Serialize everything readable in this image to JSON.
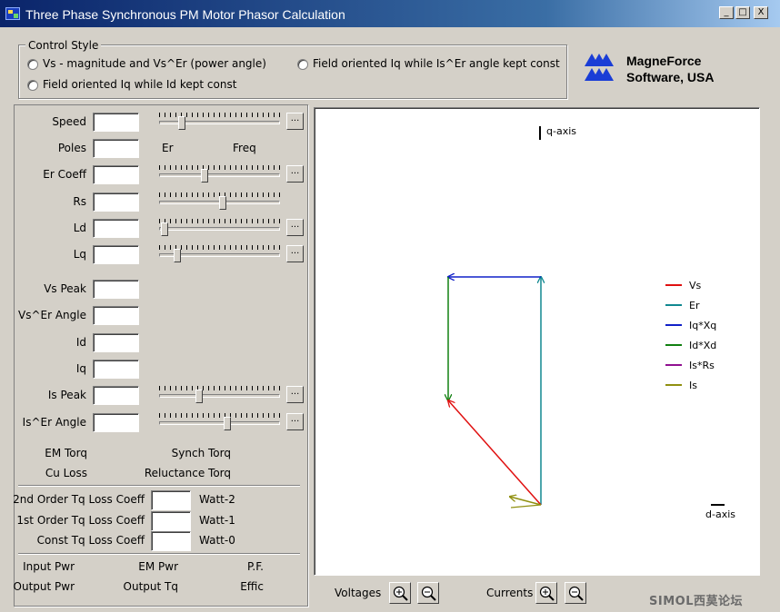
{
  "window": {
    "title": "Three Phase Synchronous PM Motor Phasor Calculation",
    "minimize": "_",
    "maximize": "□",
    "close": "X"
  },
  "control_style": {
    "label": "Control Style",
    "options": [
      {
        "label": "Vs - magnitude and Vs^Er (power angle)",
        "selected": false
      },
      {
        "label": "Field oriented Iq while Is^Er angle kept const",
        "selected": false
      },
      {
        "label": "Field oriented Iq while Id kept const",
        "selected": false
      }
    ]
  },
  "brand": {
    "line1": "MagneForce",
    "line2": "Software, USA"
  },
  "inputs": {
    "speed": "Speed",
    "poles": "Poles",
    "er_coeff": "Er Coeff",
    "rs": "Rs",
    "ld": "Ld",
    "lq": "Lq",
    "er_label": "Er",
    "freq_label": "Freq",
    "dots": "..."
  },
  "sliders": {
    "speed": 0.16,
    "er_coeff": 0.35,
    "rs": 0.51,
    "ld": 0.02,
    "lq": 0.12,
    "is_peak": 0.31,
    "is_er_angle": 0.55
  },
  "outputs": {
    "vs_peak": "Vs Peak",
    "vs_er_angle": "Vs^Er Angle",
    "id": "Id",
    "iq": "Iq",
    "is_peak": "Is Peak",
    "is_er_angle": "Is^Er Angle"
  },
  "torque": {
    "em_torq": "EM Torq",
    "synch_torq": "Synch Torq",
    "cu_loss": "Cu Loss",
    "reluctance_torq": "Reluctance Torq"
  },
  "loss": {
    "second": {
      "label": "2nd Order Tq Loss Coeff",
      "unit": "Watt-2"
    },
    "first": {
      "label": "1st Order Tq  Loss Coeff",
      "unit": "Watt-1"
    },
    "const": {
      "label": "Const Tq Loss Coeff",
      "unit": "Watt-0"
    }
  },
  "power": {
    "input_pwr": "Input Pwr",
    "em_pwr": "EM Pwr",
    "pf": "P.F.",
    "output_pwr": "Output Pwr",
    "output_tq": "Output Tq",
    "effic": "Effic"
  },
  "plot": {
    "q_axis": "q-axis",
    "d_axis": "d-axis",
    "legend": [
      {
        "name": "Vs",
        "color": "#e01010"
      },
      {
        "name": "Er",
        "color": "#108890"
      },
      {
        "name": "Iq*Xq",
        "color": "#1020c8"
      },
      {
        "name": "Id*Xd",
        "color": "#108010"
      },
      {
        "name": "Is*Rs",
        "color": "#901090"
      },
      {
        "name": "Is",
        "color": "#909010"
      }
    ]
  },
  "zoom": {
    "voltages": "Voltages",
    "currents": "Currents"
  },
  "watermark": "SIMOL西莫论坛"
}
